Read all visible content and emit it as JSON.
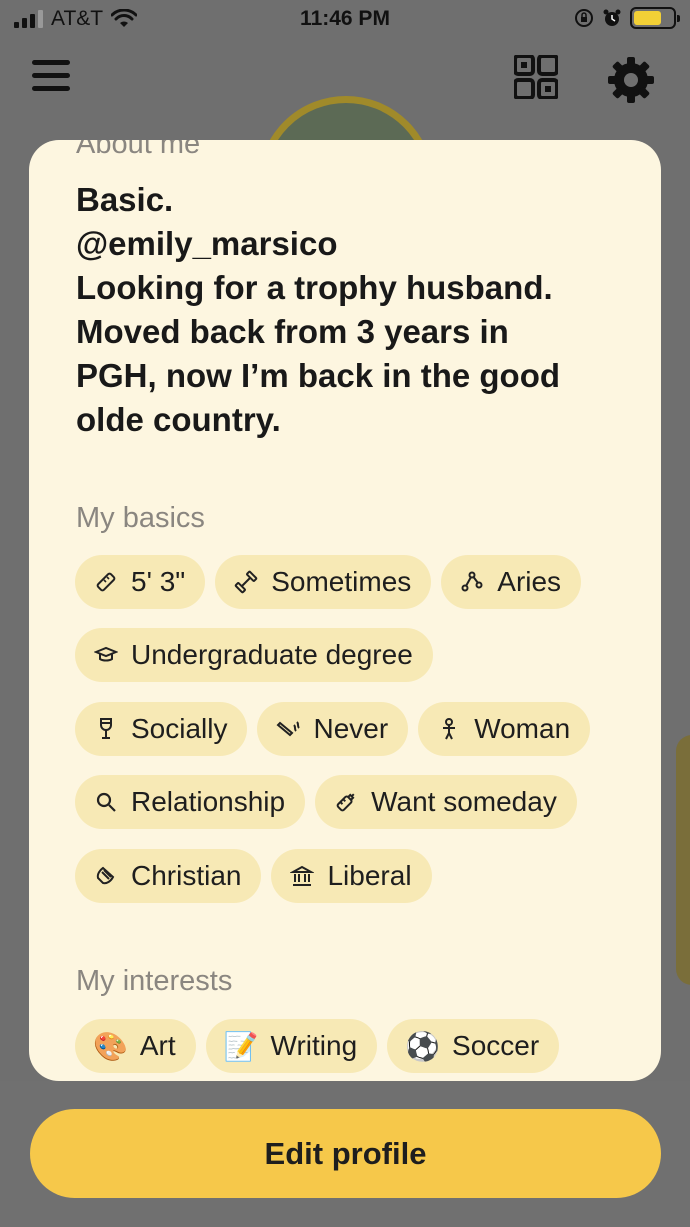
{
  "status_bar": {
    "carrier": "AT&T",
    "time": "11:46 PM"
  },
  "nav": {
    "menu_icon": "hamburger-menu-icon",
    "qr_icon": "qr-code-icon",
    "settings_icon": "gear-icon"
  },
  "about": {
    "label": "About me",
    "bio_lines": [
      "Basic.",
      "@emily_marsico",
      "Looking for a trophy husband.",
      "Moved back from 3 years in",
      "PGH, now I’m back in the good",
      "olde country."
    ]
  },
  "basics": {
    "label": "My basics",
    "chips": [
      {
        "icon": "ruler-icon",
        "label": "5' 3\""
      },
      {
        "icon": "dumbbell-icon",
        "label": "Sometimes"
      },
      {
        "icon": "zodiac-icon",
        "label": "Aries"
      },
      {
        "icon": "graduation-cap-icon",
        "label": "Undergraduate degree"
      },
      {
        "icon": "wine-glass-icon",
        "label": "Socially"
      },
      {
        "icon": "cigarette-icon",
        "label": "Never"
      },
      {
        "icon": "gender-icon",
        "label": "Woman"
      },
      {
        "icon": "magnifier-icon",
        "label": "Relationship"
      },
      {
        "icon": "baby-bottle-icon",
        "label": "Want someday"
      },
      {
        "icon": "praying-hands-icon",
        "label": "Christian"
      },
      {
        "icon": "government-building-icon",
        "label": "Liberal"
      }
    ]
  },
  "interests": {
    "label": "My interests",
    "chips": [
      {
        "emoji": "🎨",
        "label": "Art"
      },
      {
        "emoji": "📝",
        "label": "Writing"
      },
      {
        "emoji": "⚽",
        "label": "Soccer"
      }
    ]
  },
  "edit_button": "Edit profile",
  "colors": {
    "accent": "#f6c84a",
    "card_bg": "#fdf6e0",
    "chip_bg": "#f7e9b5",
    "overlay": "#6f6f6f"
  }
}
